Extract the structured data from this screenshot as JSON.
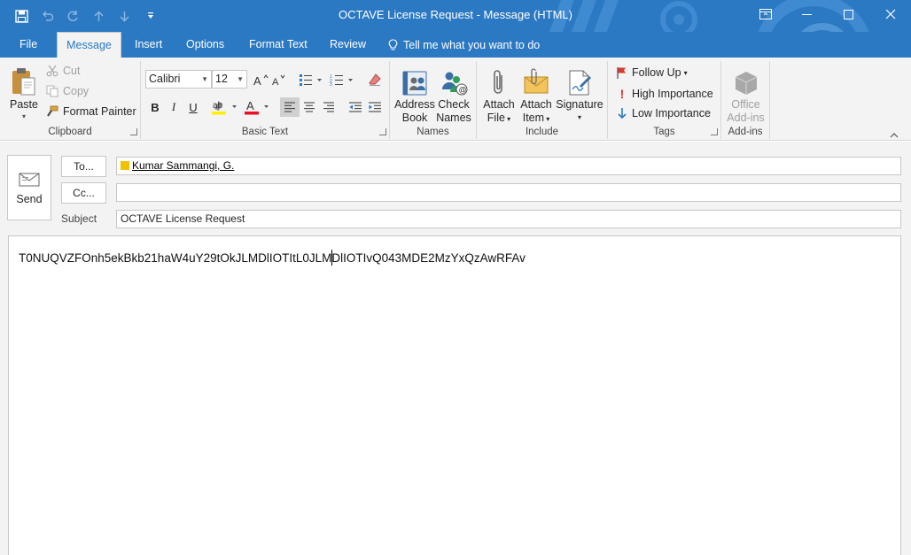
{
  "window": {
    "title": "OCTAVE License Request  -  Message (HTML)"
  },
  "tabs": [
    {
      "label": "File"
    },
    {
      "label": "Message",
      "active": true
    },
    {
      "label": "Insert"
    },
    {
      "label": "Options"
    },
    {
      "label": "Format Text"
    },
    {
      "label": "Review"
    },
    {
      "label": "Tell me what you want to do"
    }
  ],
  "ribbon": {
    "clipboard": {
      "label": "Clipboard",
      "paste": "Paste",
      "cut": "Cut",
      "copy": "Copy",
      "format_painter": "Format Painter"
    },
    "basic_text": {
      "label": "Basic Text",
      "font": "Calibri",
      "size": "12"
    },
    "names": {
      "label": "Names",
      "address_book_1": "Address",
      "address_book_2": "Book",
      "check_names_1": "Check",
      "check_names_2": "Names"
    },
    "include": {
      "label": "Include",
      "attach_file_1": "Attach",
      "attach_file_2": "File",
      "attach_item_1": "Attach",
      "attach_item_2": "Item",
      "signature": "Signature"
    },
    "tags": {
      "label": "Tags",
      "follow_up": "Follow Up",
      "high_importance": "High Importance",
      "low_importance": "Low Importance"
    },
    "addins": {
      "label": "Add-ins",
      "office_1": "Office",
      "office_2": "Add-ins"
    }
  },
  "compose": {
    "send": "Send",
    "to_button": "To...",
    "cc_button": "Cc...",
    "subject_label": "Subject",
    "to_value": "Kumar Sammangi, G.",
    "cc_value": "",
    "subject_value": "OCTAVE License Request",
    "body_text": "T0NUQVZFOnh5ekBkb21haW4uY29tOkJLMDlIOTItL0JLMDlIOTIvQ043MDE2MzYxQzAwRFAv"
  },
  "colors": {
    "accent": "#2b79c2",
    "ribbon_bg": "#f3f3f3",
    "flag_red": "#d83b2d",
    "importance_red": "#d13438"
  }
}
